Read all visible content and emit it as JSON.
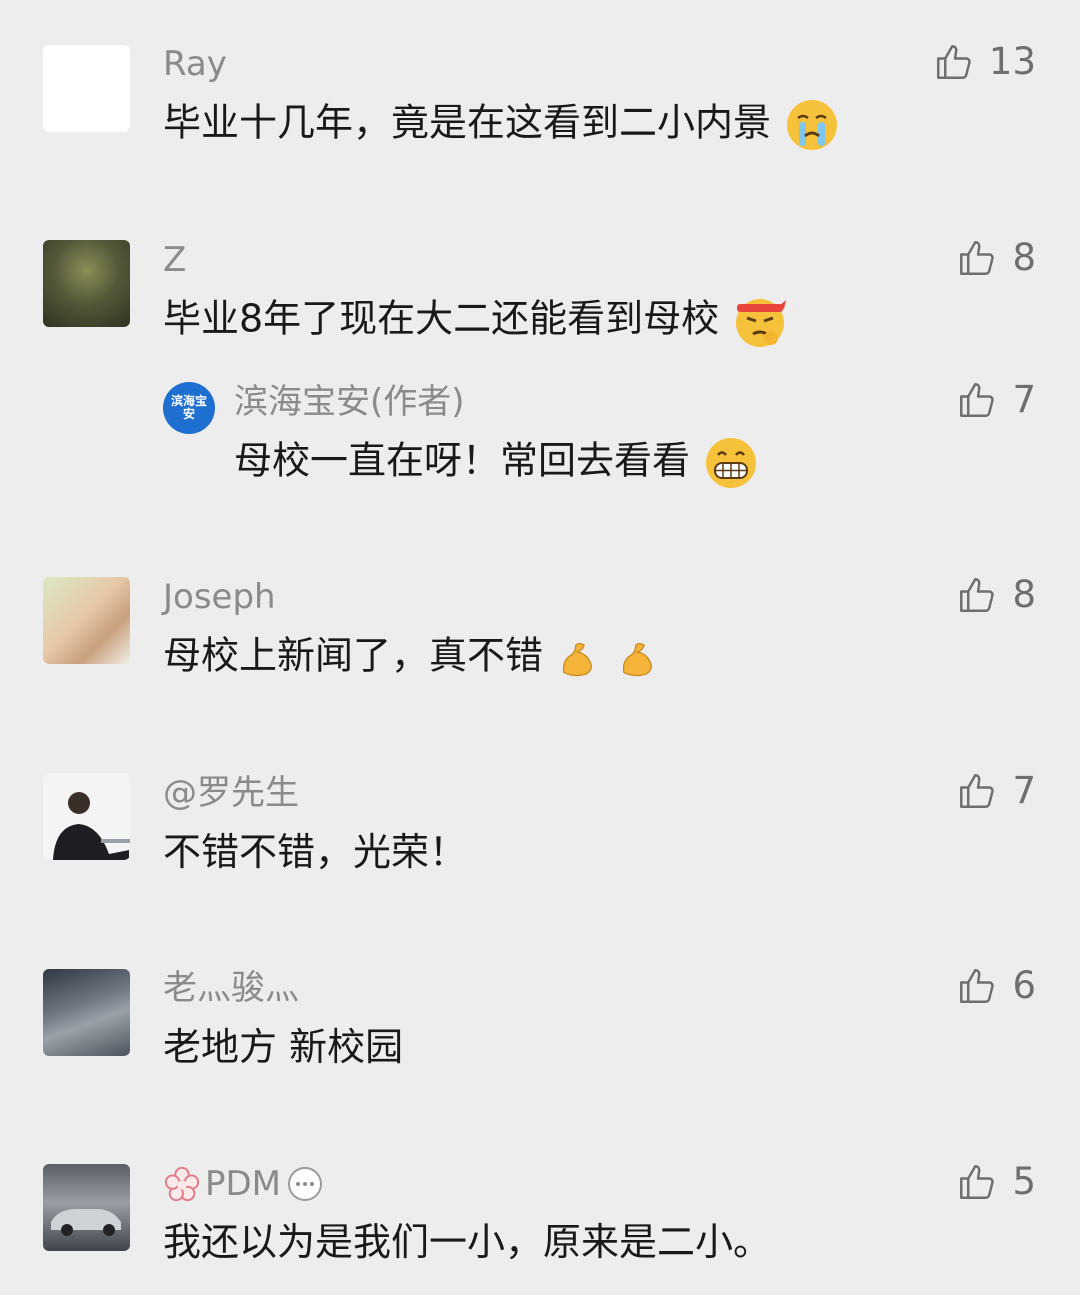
{
  "comments": [
    {
      "name": "Ray",
      "text": "毕业十几年，竟是在这看到二小内景",
      "likes": "13",
      "emoji": "crying-emoji"
    },
    {
      "name": "Z",
      "text": "毕业8年了现在大二还能看到母校",
      "likes": "8",
      "emoji": "determined-emoji",
      "reply": {
        "name": "滨海宝安(作者)",
        "text": "母校一直在呀！常回去看看",
        "likes": "7",
        "emoji": "grin-emoji",
        "avatar_text": "滨海宝安"
      }
    },
    {
      "name": "Joseph",
      "text": "母校上新闻了，真不错",
      "likes": "8",
      "emoji": "flexed-biceps-emoji"
    },
    {
      "name": "@罗先生",
      "text": "不错不错，光荣！",
      "likes": "7"
    },
    {
      "name": "老灬骏灬",
      "text": "老地方 新校园",
      "likes": "6"
    },
    {
      "name": "PDM",
      "text": "我还以为是我们一小，原来是二小。",
      "likes": "5"
    }
  ],
  "colors": {
    "background": "#ededed",
    "name": "#8a8a8a",
    "text": "#191919",
    "like": "#6e6e6e"
  }
}
